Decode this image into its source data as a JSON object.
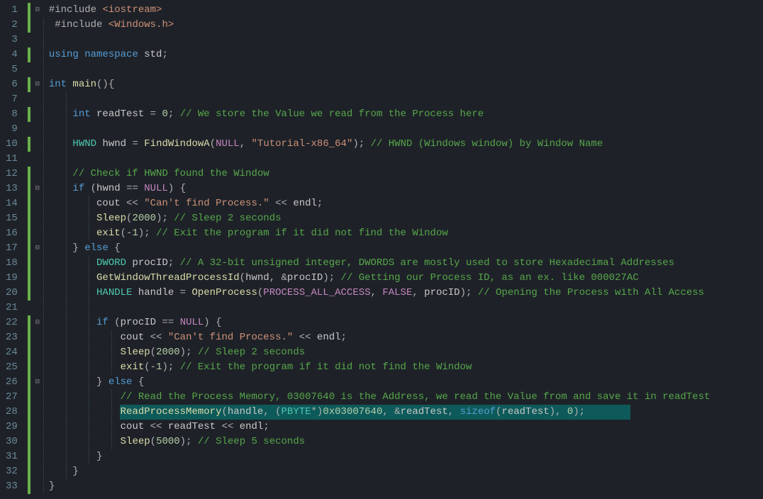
{
  "lineCount": 33,
  "changeBars": {
    "1": true,
    "2": true,
    "4": true,
    "6": true,
    "8": true,
    "10": true,
    "12": true,
    "13": true,
    "14": true,
    "15": true,
    "16": true,
    "17": true,
    "18": true,
    "19": true,
    "20": true,
    "22": true,
    "23": true,
    "24": true,
    "25": true,
    "26": true,
    "27": true,
    "28": true,
    "29": true,
    "30": true,
    "31": true,
    "32": true,
    "33": true
  },
  "foldMarkers": {
    "1": "⊟",
    "6": "⊟",
    "13": "⊟",
    "17": "⊟",
    "22": "⊟",
    "26": "⊟"
  },
  "guides": {
    "2": [
      0
    ],
    "3": [
      0
    ],
    "4": [
      0
    ],
    "5": [
      0
    ],
    "6": [
      0
    ],
    "7": [
      0,
      1
    ],
    "8": [
      0,
      1
    ],
    "9": [
      0,
      1
    ],
    "10": [
      0,
      1
    ],
    "11": [
      0,
      1
    ],
    "12": [
      0,
      1
    ],
    "13": [
      0,
      1
    ],
    "14": [
      0,
      1,
      2
    ],
    "15": [
      0,
      1,
      2
    ],
    "16": [
      0,
      1,
      2
    ],
    "17": [
      0,
      1
    ],
    "18": [
      0,
      1,
      2
    ],
    "19": [
      0,
      1,
      2
    ],
    "20": [
      0,
      1,
      2
    ],
    "21": [
      0,
      1,
      2
    ],
    "22": [
      0,
      1,
      2
    ],
    "23": [
      0,
      1,
      2,
      3
    ],
    "24": [
      0,
      1,
      2,
      3
    ],
    "25": [
      0,
      1,
      2,
      3
    ],
    "26": [
      0,
      1,
      2
    ],
    "27": [
      0,
      1,
      2,
      3
    ],
    "28": [
      0,
      1,
      2,
      3
    ],
    "29": [
      0,
      1,
      2,
      3
    ],
    "30": [
      0,
      1,
      2,
      3
    ],
    "31": [
      0,
      1,
      2
    ],
    "32": [
      0,
      1
    ],
    "33": [
      0
    ]
  },
  "highlightLine": 28,
  "highlightLeft": 108,
  "highlightWidth": 720,
  "indentUnit": 32,
  "lines": {
    "1": [
      [
        "preproc",
        "#include "
      ],
      [
        "string",
        "<iostream>"
      ]
    ],
    "2": [
      [
        "text",
        " "
      ],
      [
        "preproc",
        "#include "
      ],
      [
        "string",
        "<Windows.h>"
      ]
    ],
    "3": [],
    "4": [
      [
        "keyword",
        "using "
      ],
      [
        "keyword",
        "namespace "
      ],
      [
        "ident",
        "std"
      ],
      [
        "op",
        ";"
      ]
    ],
    "5": [],
    "6": [
      [
        "keyword",
        "int "
      ],
      [
        "func",
        "main"
      ],
      [
        "op",
        "(){"
      ]
    ],
    "7": [],
    "8": [
      [
        "text",
        "    "
      ],
      [
        "keyword",
        "int "
      ],
      [
        "ident",
        "readTest "
      ],
      [
        "op",
        "= "
      ],
      [
        "number",
        "0"
      ],
      [
        "op",
        "; "
      ],
      [
        "comment",
        "// We store the Value we read from the Process here"
      ]
    ],
    "9": [],
    "10": [
      [
        "text",
        "    "
      ],
      [
        "type",
        "HWND "
      ],
      [
        "ident",
        "hwnd "
      ],
      [
        "op",
        "= "
      ],
      [
        "func",
        "FindWindowA"
      ],
      [
        "op",
        "("
      ],
      [
        "const",
        "NULL"
      ],
      [
        "op",
        ", "
      ],
      [
        "string",
        "\"Tutorial-x86_64\""
      ],
      [
        "op",
        "); "
      ],
      [
        "comment",
        "// HWND (Windows window) by Window Name"
      ]
    ],
    "11": [],
    "12": [
      [
        "text",
        "    "
      ],
      [
        "comment",
        "// Check if HWND found the Window"
      ]
    ],
    "13": [
      [
        "text",
        "    "
      ],
      [
        "keyword",
        "if "
      ],
      [
        "op",
        "("
      ],
      [
        "ident",
        "hwnd "
      ],
      [
        "op",
        "== "
      ],
      [
        "const",
        "NULL"
      ],
      [
        "op",
        ") {"
      ]
    ],
    "14": [
      [
        "text",
        "        "
      ],
      [
        "ident",
        "cout "
      ],
      [
        "op",
        "<< "
      ],
      [
        "string",
        "\"Can't find Process.\""
      ],
      [
        "op",
        " << "
      ],
      [
        "ident",
        "endl"
      ],
      [
        "op",
        ";"
      ]
    ],
    "15": [
      [
        "text",
        "        "
      ],
      [
        "func",
        "Sleep"
      ],
      [
        "op",
        "("
      ],
      [
        "number",
        "2000"
      ],
      [
        "op",
        "); "
      ],
      [
        "comment",
        "// Sleep 2 seconds"
      ]
    ],
    "16": [
      [
        "text",
        "        "
      ],
      [
        "func",
        "exit"
      ],
      [
        "op",
        "("
      ],
      [
        "op",
        "-"
      ],
      [
        "number",
        "1"
      ],
      [
        "op",
        "); "
      ],
      [
        "comment",
        "// Exit the program if it did not find the Window"
      ]
    ],
    "17": [
      [
        "text",
        "    "
      ],
      [
        "op",
        "} "
      ],
      [
        "keyword",
        "else "
      ],
      [
        "op",
        "{"
      ]
    ],
    "18": [
      [
        "text",
        "        "
      ],
      [
        "type",
        "DWORD "
      ],
      [
        "ident",
        "procID"
      ],
      [
        "op",
        "; "
      ],
      [
        "comment",
        "// A 32-bit unsigned integer, DWORDS are mostly used to store Hexadecimal Addresses"
      ]
    ],
    "19": [
      [
        "text",
        "        "
      ],
      [
        "func",
        "GetWindowThreadProcessId"
      ],
      [
        "op",
        "("
      ],
      [
        "ident",
        "hwnd"
      ],
      [
        "op",
        ", &"
      ],
      [
        "ident",
        "procID"
      ],
      [
        "op",
        "); "
      ],
      [
        "comment",
        "// Getting our Process ID, as an ex. like 000027AC"
      ]
    ],
    "20": [
      [
        "text",
        "        "
      ],
      [
        "type",
        "HANDLE "
      ],
      [
        "ident",
        "handle "
      ],
      [
        "op",
        "= "
      ],
      [
        "func",
        "OpenProcess"
      ],
      [
        "op",
        "("
      ],
      [
        "const",
        "PROCESS_ALL_ACCESS"
      ],
      [
        "op",
        ", "
      ],
      [
        "const",
        "FALSE"
      ],
      [
        "op",
        ", "
      ],
      [
        "ident",
        "procID"
      ],
      [
        "op",
        "); "
      ],
      [
        "comment",
        "// Opening the Process with All Access"
      ]
    ],
    "21": [],
    "22": [
      [
        "text",
        "        "
      ],
      [
        "keyword",
        "if "
      ],
      [
        "op",
        "("
      ],
      [
        "ident",
        "procID "
      ],
      [
        "op",
        "== "
      ],
      [
        "const",
        "NULL"
      ],
      [
        "op",
        ") {"
      ]
    ],
    "23": [
      [
        "text",
        "            "
      ],
      [
        "ident",
        "cout "
      ],
      [
        "op",
        "<< "
      ],
      [
        "string",
        "\"Can't find Process.\""
      ],
      [
        "op",
        " << "
      ],
      [
        "ident",
        "endl"
      ],
      [
        "op",
        ";"
      ]
    ],
    "24": [
      [
        "text",
        "            "
      ],
      [
        "func",
        "Sleep"
      ],
      [
        "op",
        "("
      ],
      [
        "number",
        "2000"
      ],
      [
        "op",
        "); "
      ],
      [
        "comment",
        "// Sleep 2 seconds"
      ]
    ],
    "25": [
      [
        "text",
        "            "
      ],
      [
        "func",
        "exit"
      ],
      [
        "op",
        "("
      ],
      [
        "op",
        "-"
      ],
      [
        "number",
        "1"
      ],
      [
        "op",
        "); "
      ],
      [
        "comment",
        "// Exit the program if it did not find the Window"
      ]
    ],
    "26": [
      [
        "text",
        "        "
      ],
      [
        "op",
        "} "
      ],
      [
        "keyword",
        "else "
      ],
      [
        "op",
        "{"
      ]
    ],
    "27": [
      [
        "text",
        "            "
      ],
      [
        "comment",
        "// Read the Process Memory, 03007640 is the Address, we read the Value from and save it in readTest"
      ]
    ],
    "28": [
      [
        "text",
        "            "
      ],
      [
        "func",
        "ReadProcessMemory"
      ],
      [
        "op",
        "("
      ],
      [
        "ident",
        "handle"
      ],
      [
        "op",
        ", ("
      ],
      [
        "type",
        "PBYTE"
      ],
      [
        "op",
        "*)"
      ],
      [
        "number",
        "0x03007640"
      ],
      [
        "op",
        ", &"
      ],
      [
        "ident",
        "readTest"
      ],
      [
        "op",
        ", "
      ],
      [
        "keyword",
        "sizeof"
      ],
      [
        "op",
        "("
      ],
      [
        "ident",
        "readTest"
      ],
      [
        "op",
        "), "
      ],
      [
        "number",
        "0"
      ],
      [
        "op",
        ");"
      ]
    ],
    "29": [
      [
        "text",
        "            "
      ],
      [
        "ident",
        "cout "
      ],
      [
        "op",
        "<< "
      ],
      [
        "ident",
        "readTest "
      ],
      [
        "op",
        "<< "
      ],
      [
        "ident",
        "endl"
      ],
      [
        "op",
        ";"
      ]
    ],
    "30": [
      [
        "text",
        "            "
      ],
      [
        "func",
        "Sleep"
      ],
      [
        "op",
        "("
      ],
      [
        "number",
        "5000"
      ],
      [
        "op",
        "); "
      ],
      [
        "comment",
        "// Sleep 5 seconds"
      ]
    ],
    "31": [
      [
        "text",
        "        "
      ],
      [
        "op",
        "}"
      ]
    ],
    "32": [
      [
        "text",
        "    "
      ],
      [
        "op",
        "}"
      ]
    ],
    "33": [
      [
        "op",
        "}"
      ]
    ]
  },
  "cssClass": {
    "preproc": "c-preproc",
    "keyword": "c-keyword",
    "type": "c-type",
    "number": "c-number",
    "string": "c-string",
    "comment": "c-comment",
    "func": "c-func",
    "const": "c-const",
    "text": "c-text",
    "op": "c-op",
    "ident": "c-ident"
  }
}
